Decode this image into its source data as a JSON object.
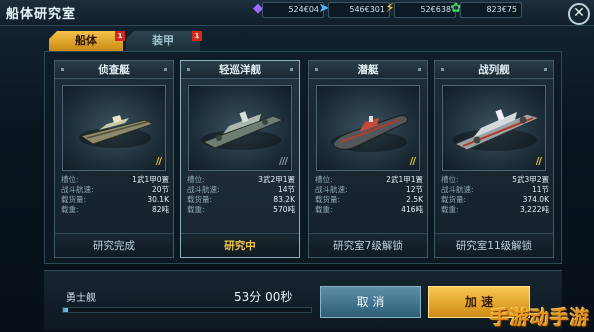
{
  "window": {
    "title": "船体研究室"
  },
  "resources": [
    {
      "icon": "purple-crystal-icon",
      "value": "524€04",
      "color": "#9a6cff"
    },
    {
      "icon": "blue-fighter-icon",
      "value": "546€301",
      "color": "#4cb8ff"
    },
    {
      "icon": "lightning-icon",
      "value": "52€638",
      "color": "#ffd84a"
    },
    {
      "icon": "green-plant-icon",
      "value": "823€75",
      "color": "#4cd46a"
    }
  ],
  "tabs": [
    {
      "label": "船体",
      "badge": "1",
      "active": true
    },
    {
      "label": "装甲",
      "badge": "1",
      "active": false
    }
  ],
  "stat_labels": [
    "槽位:",
    "战斗航速:",
    "载货量:",
    "载重:"
  ],
  "cards": [
    {
      "name": "侦查艇",
      "slots": "1武1甲0置",
      "speed": "20节",
      "cargo": "30.1K",
      "load": "82吨",
      "status": "研究完成",
      "stripes": "yellow",
      "accent": "#d8c23a"
    },
    {
      "name": "轻巡洋舰",
      "slots": "3武2甲1置",
      "speed": "14节",
      "cargo": "83.2K",
      "load": "570吨",
      "status": "研究中",
      "stripes": "gray",
      "accent": "#8a9aa2"
    },
    {
      "name": "潜艇",
      "slots": "2武1甲1置",
      "speed": "12节",
      "cargo": "2.5K",
      "load": "416吨",
      "status": "研究室7级解锁",
      "stripes": "yellow",
      "accent": "#d8c23a"
    },
    {
      "name": "战列舰",
      "slots": "5武3甲2置",
      "speed": "11节",
      "cargo": "374.0K",
      "load": "3,222吨",
      "status": "研究室11级解锁",
      "stripes": "yellow",
      "accent": "#d8c23a"
    }
  ],
  "research": {
    "ship_name": "勇士舰",
    "time_left": "53分 00秒",
    "progress_fraction": 0.02,
    "cancel_label": "取 消",
    "speedup_label": "加 速"
  },
  "watermark": "手游动手游"
}
